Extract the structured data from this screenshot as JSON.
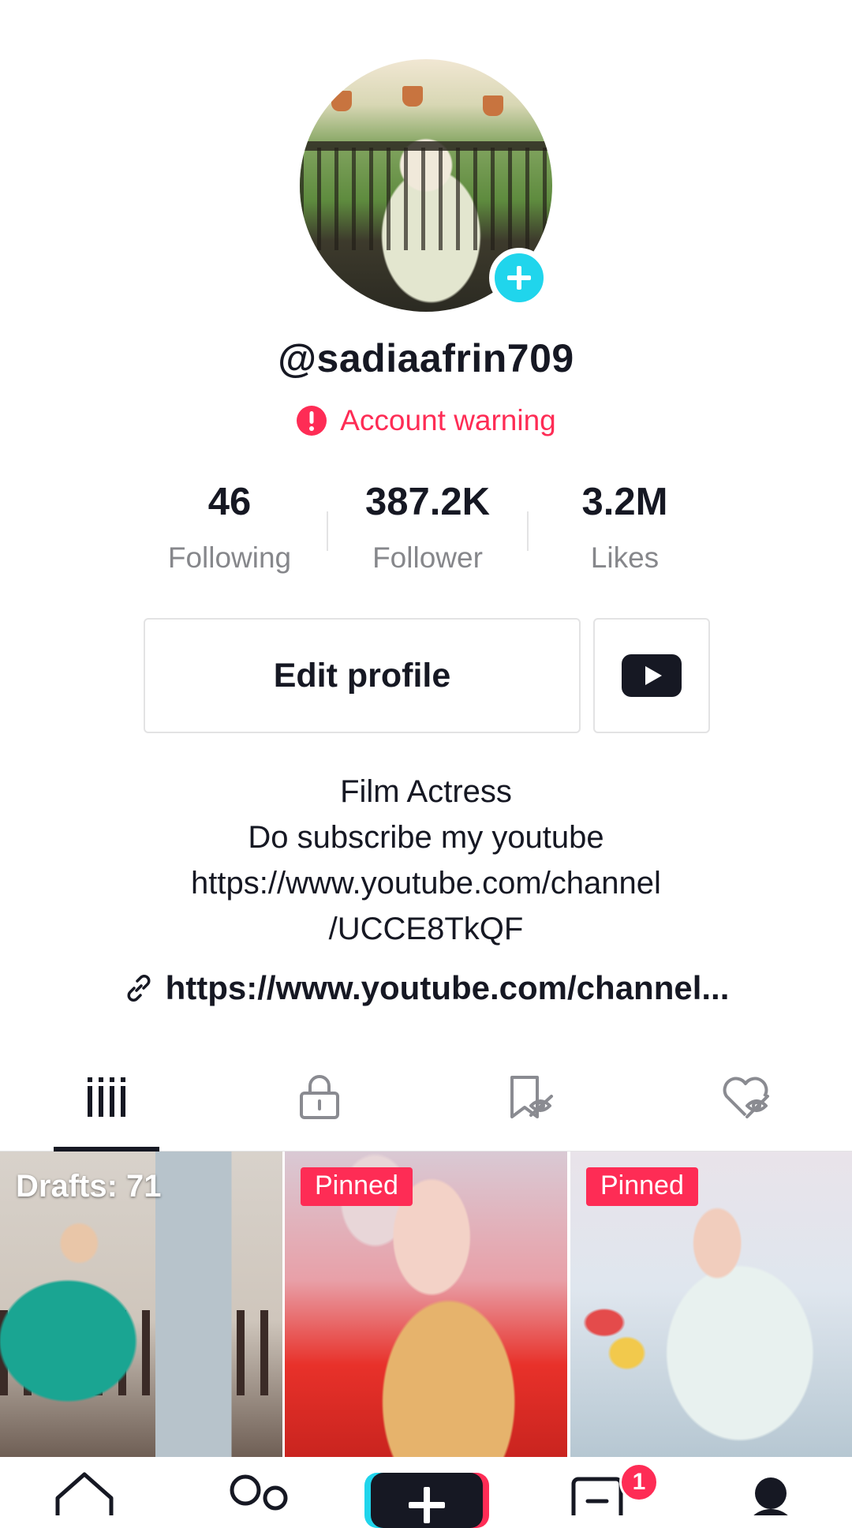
{
  "profile": {
    "username": "@sadiaafrin709",
    "warning": "Account warning"
  },
  "stats": [
    {
      "value": "46",
      "label": "Following"
    },
    {
      "value": "387.2K",
      "label": "Follower"
    },
    {
      "value": "3.2M",
      "label": "Likes"
    }
  ],
  "buttons": {
    "edit_profile": "Edit profile"
  },
  "bio": {
    "lines": [
      "Film Actress",
      "Do subscribe my youtube",
      "https://www.youtube.com/channel",
      "/UCCE8TkQF"
    ],
    "link": "https://www.youtube.com/channel..."
  },
  "grid": {
    "drafts_label": "Drafts: 71",
    "pinned_label": "Pinned"
  },
  "nav": {
    "inbox_count": "1"
  },
  "colors": {
    "accent_red": "#fe2c55",
    "accent_cyan": "#20d5ec",
    "text": "#161823",
    "muted": "#86878b"
  }
}
